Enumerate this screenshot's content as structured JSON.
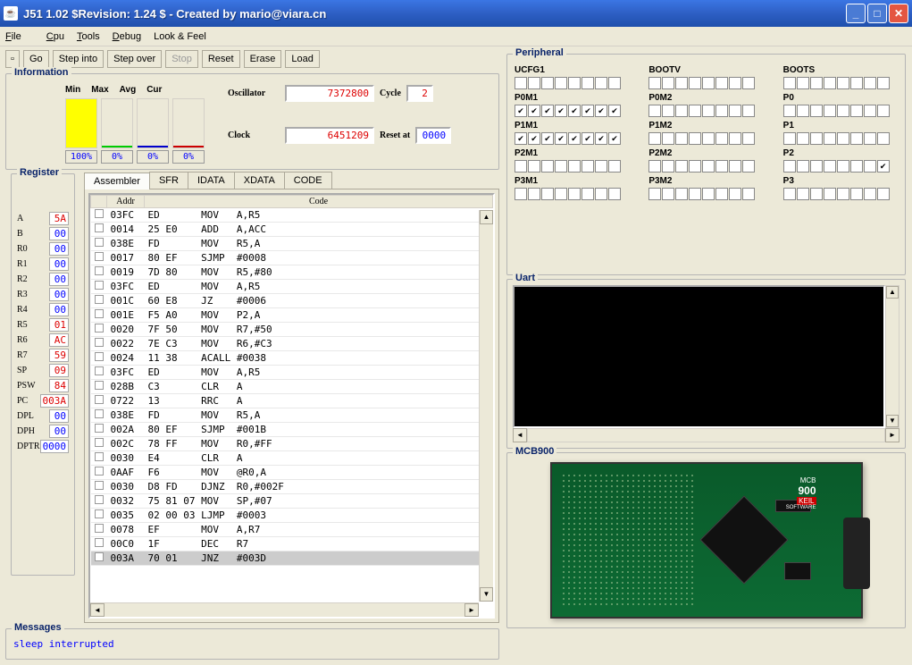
{
  "window": {
    "title": "J51 1.02 $Revision: 1.24 $ - Created by mario@viara.cn"
  },
  "menu": {
    "file": "File",
    "cpu": "Cpu",
    "tools": "Tools",
    "debug": "Debug",
    "look_feel": "Look & Feel"
  },
  "toolbar": {
    "go": "Go",
    "step_into": "Step into",
    "step_over": "Step over",
    "stop": "Stop",
    "reset": "Reset",
    "erase": "Erase",
    "load": "Load"
  },
  "information": {
    "title": "Information",
    "hdr_min": "Min",
    "hdr_max": "Max",
    "hdr_avg": "Avg",
    "hdr_cur": "Cur",
    "pct_min": "100%",
    "pct_max": "0%",
    "pct_avg": "0%",
    "pct_cur": "0%",
    "oscillator_label": "Oscillator",
    "oscillator_value": "7372800",
    "cycle_label": "Cycle",
    "cycle_value": "2",
    "clock_label": "Clock",
    "clock_value": "6451209",
    "reset_label": "Reset at",
    "reset_value": "0000"
  },
  "register": {
    "title": "Register",
    "rows": [
      {
        "l": "A",
        "v": "5A",
        "c": "red"
      },
      {
        "l": "B",
        "v": "00",
        "c": "blue"
      },
      {
        "l": "R0",
        "v": "00",
        "c": "blue"
      },
      {
        "l": "R1",
        "v": "00",
        "c": "blue"
      },
      {
        "l": "R2",
        "v": "00",
        "c": "blue"
      },
      {
        "l": "R3",
        "v": "00",
        "c": "blue"
      },
      {
        "l": "R4",
        "v": "00",
        "c": "blue"
      },
      {
        "l": "R5",
        "v": "01",
        "c": "red"
      },
      {
        "l": "R6",
        "v": "AC",
        "c": "red"
      },
      {
        "l": "R7",
        "v": "59",
        "c": "red"
      },
      {
        "l": "SP",
        "v": "09",
        "c": "red"
      },
      {
        "l": "PSW",
        "v": "84",
        "c": "red"
      },
      {
        "l": "PC",
        "v": "003A",
        "c": "red"
      },
      {
        "l": "DPL",
        "v": "00",
        "c": "blue"
      },
      {
        "l": "DPH",
        "v": "00",
        "c": "blue"
      },
      {
        "l": "DPTR",
        "v": "0000",
        "c": "blue"
      }
    ]
  },
  "codeview": {
    "tabs": [
      "Assembler",
      "SFR",
      "IDATA",
      "XDATA",
      "CODE"
    ],
    "active_tab": 0,
    "h_addr": "Addr",
    "h_code": "Code",
    "rows": [
      {
        "addr": "03FC",
        "bytes": "ED      ",
        "mn": "MOV  ",
        "arg": "A,R5"
      },
      {
        "addr": "0014",
        "bytes": "25 E0   ",
        "mn": "ADD  ",
        "arg": "A,ACC"
      },
      {
        "addr": "038E",
        "bytes": "FD      ",
        "mn": "MOV  ",
        "arg": "R5,A"
      },
      {
        "addr": "0017",
        "bytes": "80 EF   ",
        "mn": "SJMP ",
        "arg": "#0008"
      },
      {
        "addr": "0019",
        "bytes": "7D 80   ",
        "mn": "MOV  ",
        "arg": "R5,#80"
      },
      {
        "addr": "03FC",
        "bytes": "ED      ",
        "mn": "MOV  ",
        "arg": "A,R5"
      },
      {
        "addr": "001C",
        "bytes": "60 E8   ",
        "mn": "JZ   ",
        "arg": "#0006"
      },
      {
        "addr": "001E",
        "bytes": "F5 A0   ",
        "mn": "MOV  ",
        "arg": "P2,A"
      },
      {
        "addr": "0020",
        "bytes": "7F 50   ",
        "mn": "MOV  ",
        "arg": "R7,#50"
      },
      {
        "addr": "0022",
        "bytes": "7E C3   ",
        "mn": "MOV  ",
        "arg": "R6,#C3"
      },
      {
        "addr": "0024",
        "bytes": "11 38   ",
        "mn": "ACALL",
        "arg": "#0038"
      },
      {
        "addr": "03FC",
        "bytes": "ED      ",
        "mn": "MOV  ",
        "arg": "A,R5"
      },
      {
        "addr": "028B",
        "bytes": "C3      ",
        "mn": "CLR  ",
        "arg": "A"
      },
      {
        "addr": "0722",
        "bytes": "13      ",
        "mn": "RRC  ",
        "arg": "A"
      },
      {
        "addr": "038E",
        "bytes": "FD      ",
        "mn": "MOV  ",
        "arg": "R5,A"
      },
      {
        "addr": "002A",
        "bytes": "80 EF   ",
        "mn": "SJMP ",
        "arg": "#001B"
      },
      {
        "addr": "002C",
        "bytes": "78 FF   ",
        "mn": "MOV  ",
        "arg": "R0,#FF"
      },
      {
        "addr": "0030",
        "bytes": "E4      ",
        "mn": "CLR  ",
        "arg": "A"
      },
      {
        "addr": "0AAF",
        "bytes": "F6      ",
        "mn": "MOV  ",
        "arg": "@R0,A"
      },
      {
        "addr": "0030",
        "bytes": "D8 FD   ",
        "mn": "DJNZ ",
        "arg": "R0,#002F"
      },
      {
        "addr": "0032",
        "bytes": "75 81 07",
        "mn": "MOV  ",
        "arg": "SP,#07"
      },
      {
        "addr": "0035",
        "bytes": "02 00 03",
        "mn": "LJMP ",
        "arg": "#0003"
      },
      {
        "addr": "0078",
        "bytes": "EF      ",
        "mn": "MOV  ",
        "arg": "A,R7"
      },
      {
        "addr": "00C0",
        "bytes": "1F      ",
        "mn": "DEC  ",
        "arg": "R7"
      },
      {
        "addr": "003A",
        "bytes": "70 01   ",
        "mn": "JNZ  ",
        "arg": "#003D",
        "sel": true
      }
    ]
  },
  "messages": {
    "title": "Messages",
    "text": "sleep interrupted"
  },
  "peripheral": {
    "title": "Peripheral",
    "items": [
      {
        "name": "UCFG1",
        "bits": [
          0,
          0,
          0,
          0,
          0,
          0,
          0,
          0
        ]
      },
      {
        "name": "BOOTV",
        "bits": [
          0,
          0,
          0,
          0,
          0,
          0,
          0,
          0
        ]
      },
      {
        "name": "BOOTS",
        "bits": [
          0,
          0,
          0,
          0,
          0,
          0,
          0,
          0
        ]
      },
      {
        "name": "P0M1",
        "bits": [
          1,
          1,
          1,
          1,
          1,
          1,
          1,
          1
        ]
      },
      {
        "name": "P0M2",
        "bits": [
          0,
          0,
          0,
          0,
          0,
          0,
          0,
          0
        ]
      },
      {
        "name": "P0",
        "bits": [
          0,
          0,
          0,
          0,
          0,
          0,
          0,
          0
        ]
      },
      {
        "name": "P1M1",
        "bits": [
          1,
          1,
          1,
          1,
          1,
          1,
          1,
          1
        ]
      },
      {
        "name": "P1M2",
        "bits": [
          0,
          0,
          0,
          0,
          0,
          0,
          0,
          0
        ]
      },
      {
        "name": "P1",
        "bits": [
          0,
          0,
          0,
          0,
          0,
          0,
          0,
          0
        ]
      },
      {
        "name": "P2M1",
        "bits": [
          0,
          0,
          0,
          0,
          0,
          0,
          0,
          0
        ]
      },
      {
        "name": "P2M2",
        "bits": [
          0,
          0,
          0,
          0,
          0,
          0,
          0,
          0
        ]
      },
      {
        "name": "P2",
        "bits": [
          0,
          0,
          0,
          0,
          0,
          0,
          0,
          1
        ]
      },
      {
        "name": "P3M1",
        "bits": [
          0,
          0,
          0,
          0,
          0,
          0,
          0,
          0
        ]
      },
      {
        "name": "P3M2",
        "bits": [
          0,
          0,
          0,
          0,
          0,
          0,
          0,
          0
        ]
      },
      {
        "name": "P3",
        "bits": [
          0,
          0,
          0,
          0,
          0,
          0,
          0,
          0
        ]
      }
    ]
  },
  "uart": {
    "title": "Uart"
  },
  "board": {
    "title": "MCB900",
    "label_line1": "MCB",
    "label_line2": "900",
    "label_line3": "KEIL",
    "label_line4": "SOFTWARE"
  }
}
